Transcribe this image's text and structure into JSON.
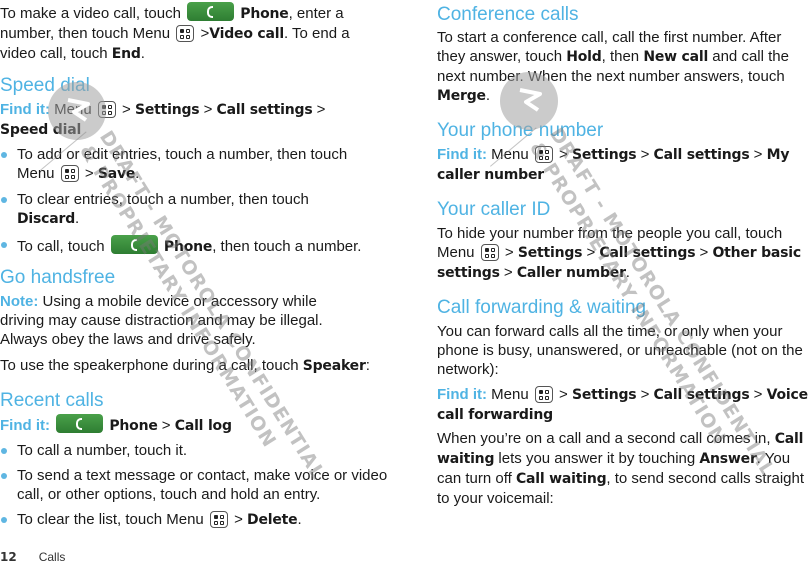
{
  "page": {
    "number": "12",
    "section": "Calls"
  },
  "icons": {
    "phone": "phone-button-icon",
    "menu": "menu-key-icon"
  },
  "colors": {
    "heading": "#4fb3e3",
    "bullet": "#5fb6e2",
    "phone_button": "#3a8f3d",
    "watermark": "#8a8a8a"
  },
  "watermark": {
    "text_line_1": "DRAFT - MOTOROLA CONFIDENTIAL",
    "text_line_2": "& PROPRIETARY INFORMATION"
  },
  "left": {
    "intro": {
      "t1": "To make a video call, touch",
      "phone": "Phone",
      "t2": ", enter a number, then touch Menu",
      "t3": " >",
      "video_call": "Video call",
      "t4": ". To end a video call, touch ",
      "end": "End",
      "t5": "."
    },
    "speed_dial": {
      "heading": "Speed dial",
      "findit_label": "Find it:",
      "findit_menu": " Menu ",
      "sep": " > ",
      "path": [
        "Settings",
        "Call settings",
        "Speed dial"
      ],
      "bullets": [
        {
          "t1": "To add or edit entries, touch a number, then touch Menu ",
          "t2": " > ",
          "bold": "Save",
          "t3": "."
        },
        {
          "t1": "To clear entries, touch a number, then touch ",
          "bold": "Discard",
          "t3": "."
        },
        {
          "t1": "To call, touch ",
          "bold": "Phone",
          "t3": ", then touch a number."
        }
      ]
    },
    "handsfree": {
      "heading": "Go handsfree",
      "note_label": "Note:",
      "note_text": " Using a mobile device or accessory while driving may cause distraction and may be illegal. Always obey the laws and drive safely.",
      "speaker_t1": "To use the speakerphone during a call, touch ",
      "speaker_bold": "Speaker",
      "speaker_t2": ":"
    },
    "recent_calls": {
      "heading": "Recent calls",
      "findit_label": "Find it:",
      "path": [
        "Phone",
        "Call log"
      ],
      "sep": " > ",
      "bullets": [
        {
          "t1": "To call a number, touch it."
        },
        {
          "t1": "To send a text message or contact, make voice or video call, or other options, touch and hold an entry."
        },
        {
          "t1": "To clear the list, touch Menu ",
          "t2": " > ",
          "bold": "Delete",
          "t3": "."
        }
      ]
    }
  },
  "right": {
    "conference": {
      "heading": "Conference calls",
      "t1": "To start a conference call, call the first number. After they answer, touch ",
      "hold": "Hold",
      "t2": ", then ",
      "new_call": "New call",
      "t3": " and call the next number. When the next number answers, touch ",
      "merge": "Merge",
      "t4": "."
    },
    "phone_number": {
      "heading": "Your phone number",
      "findit_label": "Find it:",
      "findit_menu": " Menu ",
      "sep": " > ",
      "path": [
        "Settings",
        "Call settings",
        "My caller number"
      ]
    },
    "caller_id": {
      "heading": "Your caller ID",
      "t1": "To hide your number from the people you call, touch Menu ",
      "sep": " > ",
      "path": [
        "Settings",
        "Call settings",
        "Other basic settings",
        "Caller number"
      ],
      "t2": "."
    },
    "forwarding": {
      "heading": "Call forwarding & waiting",
      "t1": "You can forward calls all the time, or only when your phone is busy, unanswered, or unreachable (not on the network):",
      "findit_label": "Find it:",
      "findit_menu": " Menu ",
      "sep": " > ",
      "path": [
        "Settings",
        "Call settings",
        "Voice call forwarding"
      ],
      "w1": "When you’re on a call and a second call comes in, ",
      "call_waiting": "Call waiting",
      "w2": " lets you answer it by touching ",
      "answer": "Answer",
      "w3": ". You can turn off ",
      "call_waiting_2": "Call waiting",
      "w4": ", to send second calls straight to your voicemail:"
    }
  }
}
